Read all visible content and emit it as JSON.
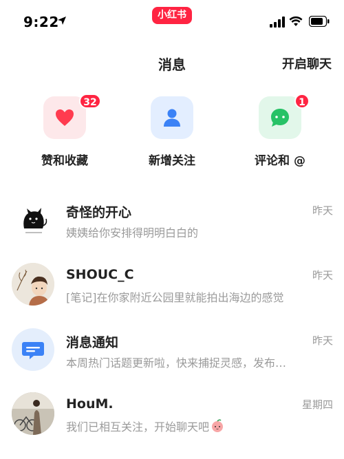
{
  "status_bar": {
    "time": "9:22",
    "app_badge": "小红书"
  },
  "header": {
    "title": "消息",
    "action": "开启聊天"
  },
  "categories": [
    {
      "label": "赞和收藏",
      "badge": "32",
      "icon": "heart-icon",
      "tile_color": "#fde8ea",
      "icon_color": "#ff3b4f"
    },
    {
      "label": "新增关注",
      "badge": "",
      "icon": "person-icon",
      "tile_color": "#e3eeff",
      "icon_color": "#3b82f6"
    },
    {
      "label": "评论和 @",
      "badge": "1",
      "icon": "chat-bubble-icon",
      "tile_color": "#e2f7ea",
      "icon_color": "#27c266"
    }
  ],
  "messages": [
    {
      "name": "奇怪的开心",
      "snippet": "姨姨给你安排得明明白白的",
      "time": "昨天"
    },
    {
      "name": "SHOUC_C",
      "snippet": "[笔记]在你家附近公园里就能拍出海边的感觉",
      "time": "昨天"
    },
    {
      "name": "消息通知",
      "snippet": "本周热门话题更新啦，快来捕捉灵感，发布…",
      "time": "昨天"
    },
    {
      "name": "HouM.",
      "snippet": "我们已相互关注，开始聊天吧",
      "time": "星期四"
    }
  ],
  "colors": {
    "brand": "#ff2442",
    "muted_text": "#9a9a9a"
  }
}
